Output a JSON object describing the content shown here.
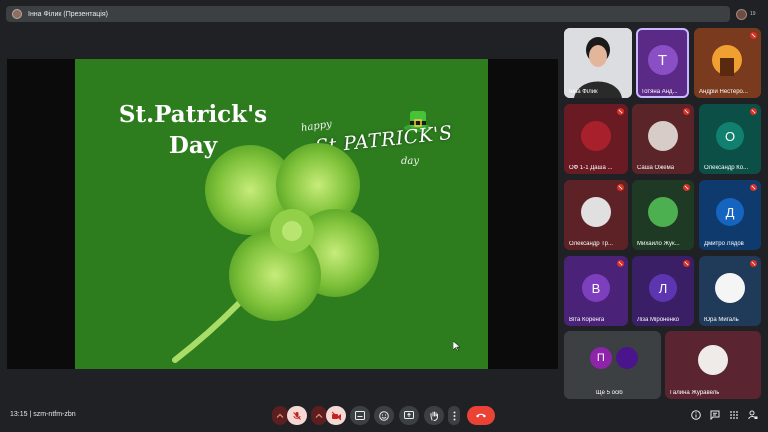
{
  "topbar": {
    "title": "Інна Філик (Презентація)",
    "count": "19"
  },
  "slide": {
    "title_line1": "St.Patrick's",
    "title_line2": "Day",
    "happy": "happy",
    "st_patricks": "St PATRICK'S",
    "day": "day"
  },
  "tiles": [
    {
      "name": "Інна Філик",
      "kind": "photo",
      "bg": "#e9eaed"
    },
    {
      "name": "Тотяна Анд...",
      "letter": "Т",
      "bg": "#5b2a86",
      "avatar": "#8a4fc4"
    },
    {
      "name": "Андрій Нестеро...",
      "kind": "photo",
      "bg": "#7a3a1e"
    },
    {
      "name": "ОФ 1-1 Даша ...",
      "kind": "photo",
      "bg": "#6a1a22"
    },
    {
      "name": "Саша Ожема",
      "kind": "photo",
      "bg": "#5a2428"
    },
    {
      "name": "Олександр Ко...",
      "letter": "О",
      "bg": "#0c4f47",
      "avatar": "#12806f"
    },
    {
      "name": "Олександр Тр...",
      "kind": "photo",
      "bg": "#5c2226"
    },
    {
      "name": "Михайло Жук...",
      "kind": "photo",
      "bg": "#1f3a24"
    },
    {
      "name": "Дмитро Лядов",
      "letter": "Д",
      "bg": "#0e3a6e",
      "avatar": "#1565c0"
    },
    {
      "name": "Віта Коренга",
      "letter": "В",
      "bg": "#4a2278",
      "avatar": "#7e3fbf"
    },
    {
      "name": "Ліза Міроненко",
      "letter": "Л",
      "bg": "#3a1f66",
      "avatar": "#5e35b1"
    },
    {
      "name": "Юра Мигаль",
      "kind": "photo",
      "bg": "#203a5a"
    },
    {
      "name": "Ще 5 осіб",
      "letter": "П",
      "bg": "#3c4043",
      "avatar": "#8e24aa"
    },
    {
      "name": "Галина Журавель",
      "kind": "photo",
      "bg": "#5a2430"
    }
  ],
  "bottombar": {
    "time": "13:15",
    "separator": "|",
    "meeting_code": "szm-ntfm-zbn"
  },
  "colors": {
    "accent_hangup": "#ea4335",
    "slide_bg": "#2d7d1f",
    "active_border": "#c8b8ff"
  }
}
